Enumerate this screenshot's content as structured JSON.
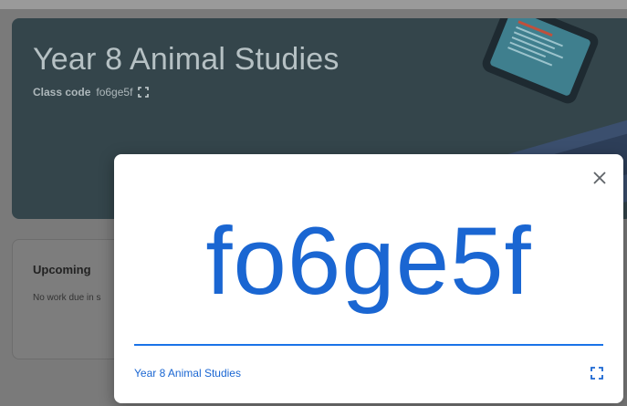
{
  "banner": {
    "title": "Year 8 Animal Studies",
    "class_code_label": "Class code",
    "class_code": "fo6ge5f"
  },
  "upcoming": {
    "title": "Upcoming",
    "text": "No work due in s"
  },
  "modal": {
    "code": "fo6ge5f",
    "class_name": "Year 8 Animal Studies",
    "accent": "#1a66d2"
  },
  "icons": [
    "fullscreen-icon",
    "close-icon",
    "device-illustration"
  ]
}
